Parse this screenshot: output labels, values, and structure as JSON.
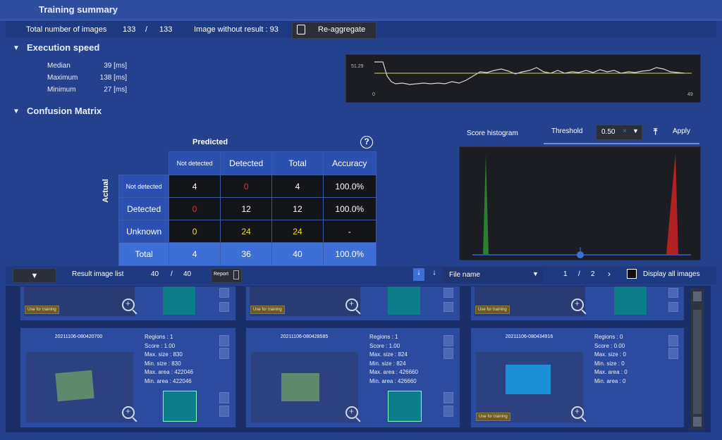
{
  "header": {
    "title": "Training summary"
  },
  "summary": {
    "total_label": "Total number of images",
    "total_a": "133",
    "total_sep": "/",
    "total_b": "133",
    "without_result": "Image without result  : 93",
    "reaggregate_label": "Re-aggregate"
  },
  "exec": {
    "title": "Execution speed",
    "median_label": "Median",
    "median_value": "39 [ms]",
    "max_label": "Maximum",
    "max_value": "138 [ms]",
    "min_label": "Minimum",
    "min_value": "27 [ms]",
    "chart_y_label": "51.29",
    "chart_x_start": "0",
    "chart_x_end": "49"
  },
  "cm": {
    "title": "Confusion Matrix",
    "predicted_label": "Predicted",
    "actual_label": "Actual",
    "help": "?",
    "columns": [
      "Not detected",
      "Detected",
      "Total",
      "Accuracy"
    ],
    "rows": [
      {
        "label": "Not detected",
        "cells": [
          "4",
          "0",
          "4",
          "100.0%"
        ]
      },
      {
        "label": "Detected",
        "cells": [
          "0",
          "12",
          "12",
          "100.0%"
        ]
      },
      {
        "label": "Unknown",
        "cells": [
          "0",
          "24",
          "24",
          "-"
        ]
      },
      {
        "label": "Total",
        "cells": [
          "4",
          "36",
          "40",
          "100.0%"
        ]
      }
    ]
  },
  "histogram": {
    "title": "Score histogram",
    "threshold_label": "Threshold",
    "threshold_value": "0.50",
    "threshold_clear": "×",
    "apply_label": "Apply"
  },
  "result_list": {
    "label": "Result image list",
    "count_a": "40",
    "count_sep": "/",
    "count_b": "40",
    "report_label": "Report",
    "sort_value": "File name",
    "page_current": "1",
    "page_sep": "/",
    "page_total": "2",
    "display_all_label": "Display all images"
  },
  "top_cards": [
    {
      "badge": "Use for training"
    },
    {
      "badge": "Use for training"
    },
    {
      "badge": "Use for training"
    }
  ],
  "cards": [
    {
      "name": "20211106-080420700",
      "regions": "Regions : 1",
      "score": "Score : 1.00",
      "max_size": "Max. size : 830",
      "min_size": "Min. size : 830",
      "max_area": "Max. area : 422046",
      "min_area": "Min. area : 422046"
    },
    {
      "name": "20211106-080428585",
      "regions": "Regions : 1",
      "score": "Score : 1.00",
      "max_size": "Max. size : 824",
      "min_size": "Min. size : 824",
      "max_area": "Max. area : 426660",
      "min_area": "Min. area : 426660"
    },
    {
      "name": "20211106-080434916",
      "regions": "Regions : 0",
      "score": "Score : 0.00",
      "max_size": "Max. size : 0",
      "min_size": "Min. size : 0",
      "max_area": "Max. area : 0",
      "min_area": "Min. area : 0",
      "badge": "Use for training"
    }
  ],
  "colors": {
    "accent": "#3d6fd6",
    "background": "#23418c",
    "error": "#e33333",
    "warning": "#f2e02a"
  }
}
